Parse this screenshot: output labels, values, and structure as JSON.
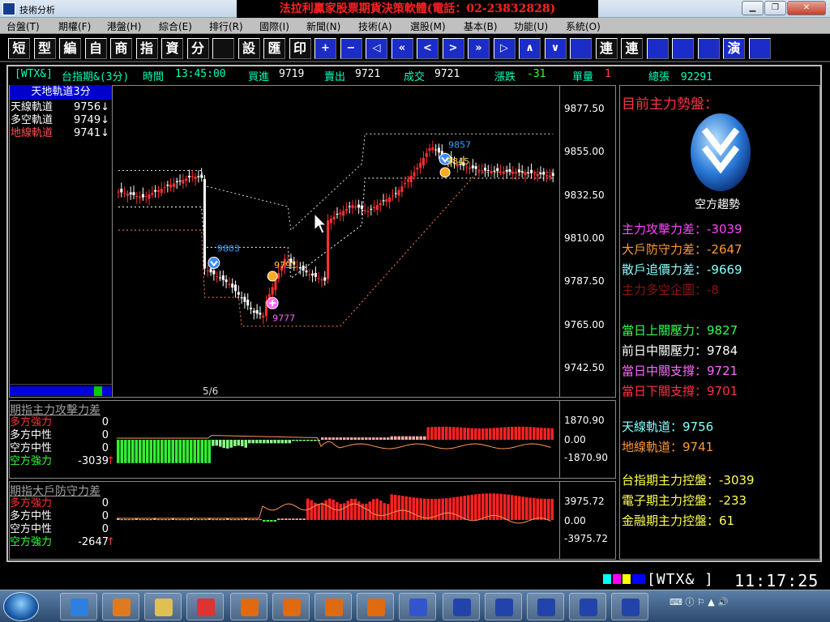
{
  "window": {
    "title": "技術分析",
    "banner": "法拉利贏家股票期貨決策軟體(電話：02-23832828)"
  },
  "menu": [
    "台盤(T)",
    "期權(F)",
    "港盤(H)",
    "綜合(E)",
    "排行(R)",
    "國際(I)",
    "新聞(N)",
    "技術(A)",
    "選股(M)",
    "基本(B)",
    "功能(U)",
    "系統(O)"
  ],
  "toolbar": [
    "短",
    "型",
    "編",
    "自",
    "商",
    "指",
    "資",
    "分",
    "",
    "設",
    "匯",
    "印",
    "+",
    "−",
    "◁",
    "«",
    "<",
    ">",
    "»",
    "▷",
    "∧",
    "∨",
    "",
    "連",
    "連",
    "",
    "",
    "",
    "演",
    ""
  ],
  "quote": {
    "symbol": "[WTX&]",
    "name": "台指期&(3分)",
    "time_label": "時間",
    "time": "13:45:00",
    "bid_label": "買進",
    "bid": "9719",
    "ask_label": "賣出",
    "ask": "9721",
    "last_label": "成交",
    "last": "9721",
    "change_label": "漲跌",
    "change": "-31",
    "vol_label": "單量",
    "vol": "1",
    "total_label": "總張",
    "total": "92291"
  },
  "indicator": {
    "title": "天地軌道3分",
    "lines": [
      {
        "label": "天線軌道",
        "value": "9756↓",
        "color": "#ffffff"
      },
      {
        "label": "多空軌道",
        "value": "9749↓",
        "color": "#ffffff"
      },
      {
        "label": "地線軌道",
        "value": "9741↓",
        "color": "#ff5050"
      }
    ],
    "page": "5/6"
  },
  "price_axis": [
    "9877.50",
    "9855.00",
    "9832.50",
    "9810.00",
    "9787.50",
    "9765.00",
    "9742.50"
  ],
  "price_range": [
    9735,
    9890
  ],
  "markers": [
    {
      "label": "9857",
      "price": 9857,
      "idx": 106,
      "kind": "sell",
      "color": "#3aa0ff"
    },
    {
      "label": "9845",
      "price": 9845,
      "idx": 106,
      "kind": "dot",
      "color": "#ffcc33"
    },
    {
      "label": "9803",
      "price": 9803,
      "idx": 31,
      "kind": "sell",
      "color": "#3aa0ff"
    },
    {
      "label": "9791",
      "price": 9791,
      "idx": 50,
      "kind": "dot",
      "color": "#ffcc33"
    },
    {
      "label": "9777",
      "price": 9777,
      "idx": 50,
      "kind": "buy",
      "color": "#ff66ff"
    }
  ],
  "sub1": {
    "title": "期指主力攻擊力差",
    "rows": [
      {
        "label": "多方強力",
        "value": "0",
        "color": "#ff3333"
      },
      {
        "label": "多方中性",
        "value": "0",
        "color": "#ffffff"
      },
      {
        "label": "空方中性",
        "value": "0",
        "color": "#ffffff"
      },
      {
        "label": "空方強力",
        "value": "-3039",
        "color": "#33ff33",
        "arrow": "↑"
      }
    ],
    "axis": [
      "1870.90",
      "0.00",
      "-1870.90"
    ]
  },
  "sub2": {
    "title": "期指大戶防守力差",
    "rows": [
      {
        "label": "多方強力",
        "value": "0",
        "color": "#ff3333"
      },
      {
        "label": "多方中性",
        "value": "0",
        "color": "#ffffff"
      },
      {
        "label": "空方中性",
        "value": "0",
        "color": "#ffffff"
      },
      {
        "label": "空方強力",
        "value": "-2647",
        "color": "#33ff33",
        "arrow": "↑"
      }
    ],
    "axis": [
      "3975.72",
      "0.00",
      "-3975.72"
    ]
  },
  "right": {
    "title": "目前主力勢盤：",
    "trend": "空方趨勢",
    "lines": [
      {
        "text": "主力攻擊力差：-3039",
        "color": "#ff44ff"
      },
      {
        "text": "大戶防守力差：-2647",
        "color": "#ff9933"
      },
      {
        "text": "散戶追價力差：-9669",
        "color": "#88ffff"
      },
      {
        "text": "主力多空企圖：-8",
        "color": "#8a1515"
      },
      {
        "text": "當日上關壓力：9827",
        "color": "#33ff55"
      },
      {
        "text": "前日中關壓力：9784",
        "color": "#ffffff"
      },
      {
        "text": "當日中關支撐：9721",
        "color": "#ff66ff"
      },
      {
        "text": "當日下關支撐：9701",
        "color": "#ff3344"
      },
      {
        "text": "天線軌道：9756",
        "color": "#88ffff"
      },
      {
        "text": "地線軌道：9741",
        "color": "#ff9933"
      },
      {
        "text": "台指期主力控盤：-3039",
        "color": "#ffff55"
      },
      {
        "text": "電子期主力控盤：-233",
        "color": "#ffff55"
      },
      {
        "text": "金融期主力控盤：61",
        "color": "#ffff55"
      }
    ]
  },
  "status": {
    "input": "[WTX& ]",
    "clock": "11:17:25"
  },
  "taskbar_apps": [
    "ie-icon",
    "media-icon",
    "folder-icon",
    "chrome-icon",
    "app1-icon",
    "app2-icon",
    "app3-icon",
    "app4-icon",
    "app5-icon",
    "chart1-icon",
    "chart2-icon",
    "chart3-icon",
    "chart4-icon",
    "chart5-icon"
  ]
}
